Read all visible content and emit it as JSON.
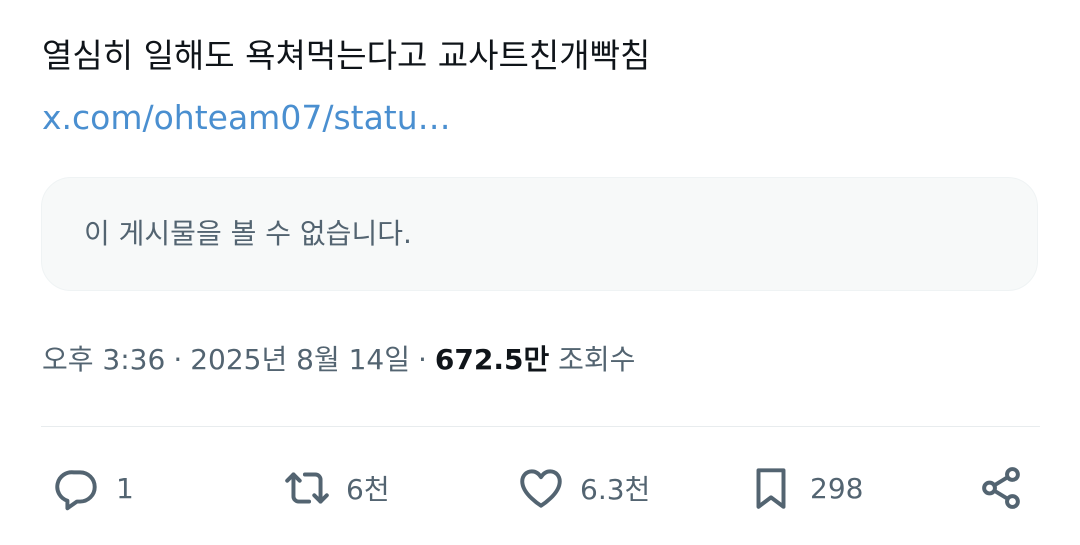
{
  "tweet": {
    "text": "열심히 일해도 욕쳐먹는다고 교사트친개빡침",
    "link": "x.com/ohteam07/statu…"
  },
  "quote": {
    "unavailable_text": "이 게시물을 볼 수 없습니다."
  },
  "meta": {
    "time": "오후 3:36",
    "separator": "·",
    "date": "2025년 8월 14일",
    "views_count": "672.5만",
    "views_label": "조회수"
  },
  "actions": {
    "reply_icon": "reply-icon",
    "reply_count": "1",
    "retweet_icon": "retweet-icon",
    "retweet_count": "6천",
    "like_icon": "heart-icon",
    "like_count": "6.3천",
    "bookmark_icon": "bookmark-icon",
    "bookmark_count": "298",
    "share_icon": "share-icon"
  },
  "colors": {
    "text": "#0f1419",
    "secondary": "#536471",
    "link": "#4a8fd0",
    "quote_bg": "#f7f9f9"
  }
}
